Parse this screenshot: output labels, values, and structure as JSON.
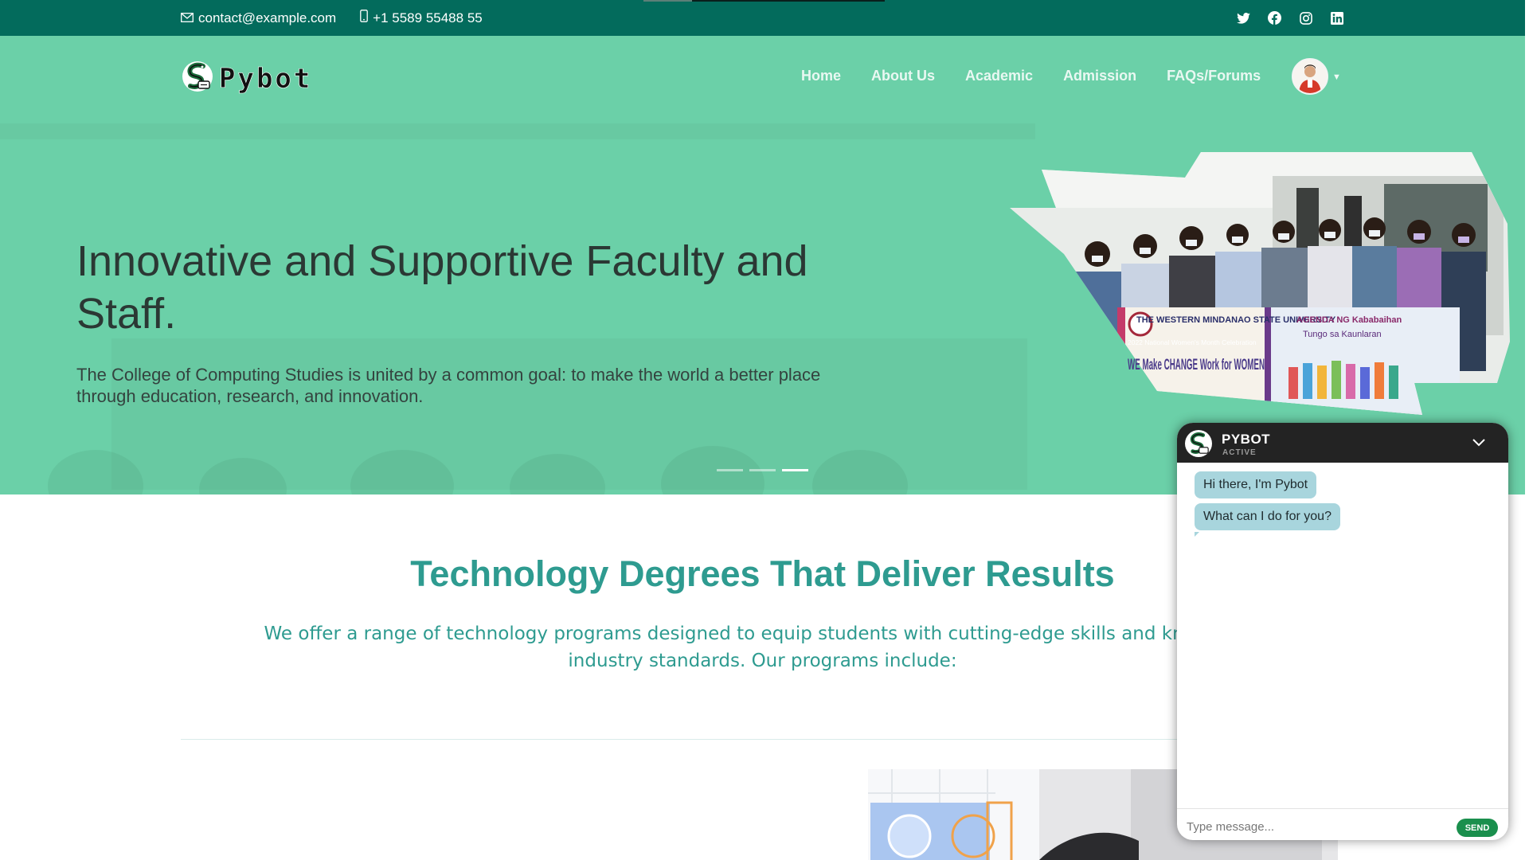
{
  "topbar": {
    "email": "contact@example.com",
    "phone": "+1 5589 55488 55",
    "social_icons": [
      "twitter-icon",
      "facebook-icon",
      "instagram-icon",
      "linkedin-icon"
    ]
  },
  "navbar": {
    "logo_text": "Pybot",
    "links": [
      "Home",
      "About Us",
      "Academic",
      "Admission",
      "FAQs/Forums"
    ]
  },
  "hero": {
    "title": "Innovative and Supportive Faculty and Staff.",
    "text": "The College of Computing Studies is united by a common goal: to make the world a better place through education, research, and innovation.",
    "slides": 3,
    "active_slide": 3,
    "photo_banner_title": "THE WESTERN MINDANAO STATE UNIVERSITY",
    "photo_banner_sub": "2022 National Women's Month Celebration",
    "photo_banner_main": "WE Make CHANGE Work for WOMEN",
    "photo_banner_agenda": "AGENDA NG Kababaihan",
    "photo_banner_agenda_sub": "Tungo sa Kaunlaran"
  },
  "section": {
    "title": "Technology Degrees That Deliver Results",
    "text": "We offer a range of technology programs designed to equip students with cutting-edge skills and knowledge industry standards. Our programs include:"
  },
  "chat": {
    "name": "PYBOT",
    "status": "ACTIVE",
    "messages": [
      "Hi there, I'm Pybot",
      "What can I do for you?"
    ],
    "input_placeholder": "Type message...",
    "send_label": "SEND"
  },
  "colors": {
    "topbar": "#036b5c",
    "hero": "#6bd0a8",
    "accent": "#2e9b90",
    "send": "#1a8f4d",
    "bubble": "#a8d5dd"
  }
}
